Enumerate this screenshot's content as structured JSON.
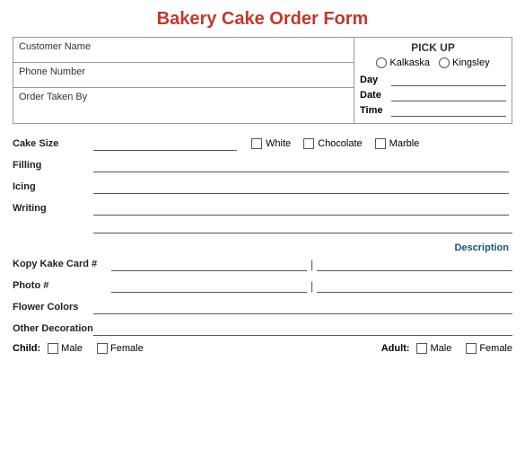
{
  "title": "Bakery Cake Order Form",
  "top": {
    "customer_name_label": "Customer Name",
    "phone_number_label": "Phone Number",
    "order_taken_label": "Order Taken By",
    "pickup_title": "PICK UP",
    "kalkaska_label": "Kalkaska",
    "kingsley_label": "Kingsley",
    "day_label": "Day",
    "date_label": "Date",
    "time_label": "Time"
  },
  "form": {
    "cake_size_label": "Cake Size",
    "white_label": "White",
    "chocolate_label": "Chocolate",
    "marble_label": "Marble",
    "filling_label": "Filling",
    "icing_label": "Icing",
    "writing_label": "Writing",
    "description_label": "Description",
    "kopy_kake_label": "Kopy Kake Card #",
    "photo_label": "Photo #",
    "flower_colors_label": "Flower Colors",
    "other_decoration_label": "Other Decoration",
    "child_label": "Child:",
    "male_label": "Male",
    "female_label": "Female",
    "adult_label": "Adult:",
    "adult_male_label": "Male",
    "adult_female_label": "Female"
  }
}
